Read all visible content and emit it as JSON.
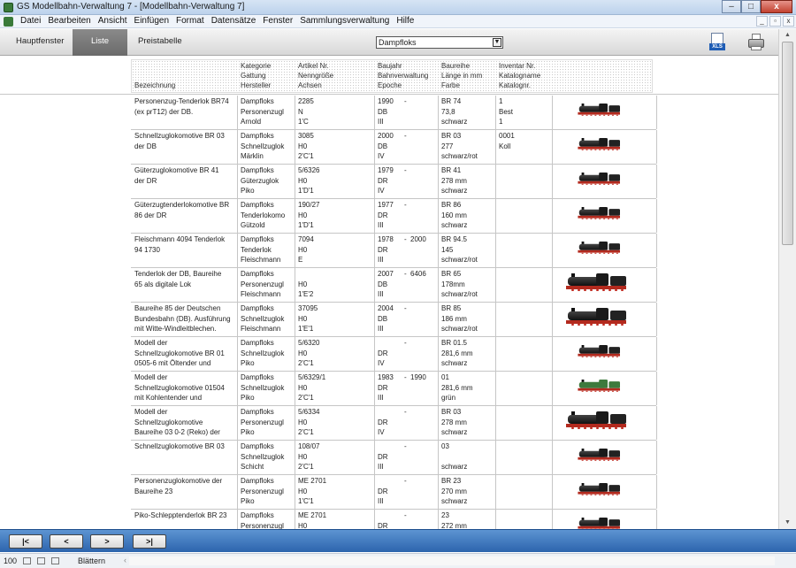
{
  "window": {
    "title": "GS Modellbahn-Verwaltung 7 - [Modellbahn-Verwaltung 7]",
    "minimize": "–",
    "maximize": "□",
    "close": "x"
  },
  "menu": [
    "Datei",
    "Bearbeiten",
    "Ansicht",
    "Einfügen",
    "Format",
    "Datensätze",
    "Fenster",
    "Sammlungsverwaltung",
    "Hilfe"
  ],
  "mdi": {
    "minimize": "_",
    "restore": "▫",
    "close": "x"
  },
  "toolbar": {
    "tabs": [
      "Hauptfenster",
      "Liste",
      "Preistabelle"
    ],
    "active_tab": "Liste",
    "category_select": "Dampfloks",
    "export_label": "XLS"
  },
  "columns": {
    "name": [
      "",
      "",
      "Bezeichnung"
    ],
    "category": [
      "Kategorie",
      "Gattung",
      "Hersteller"
    ],
    "article": [
      "Artikel Nr.",
      "Nenngröße",
      "Achsen"
    ],
    "year": [
      "Baujahr",
      "Bahnverwaltung",
      "Epoche"
    ],
    "series": [
      "Baureihe",
      "Länge in mm",
      "Farbe"
    ],
    "inventory": [
      "Inventar Nr.",
      "Katalogname",
      "Katalognr."
    ]
  },
  "rows": [
    {
      "name": [
        "Personenzug-Tenderlok BR74",
        "(ex prT12) der DB."
      ],
      "category": [
        "Dampfloks",
        "Personenzugl",
        "Arnold"
      ],
      "article": [
        "2285",
        "N",
        "1'C"
      ],
      "year": [
        "1990",
        "DB",
        "III"
      ],
      "year_dash": "-",
      "year_to": "",
      "series": [
        "BR 74",
        "73,8",
        "schwarz"
      ],
      "inventory": [
        "1",
        "Best",
        "1"
      ]
    },
    {
      "name": [
        "Schnellzuglokomotive BR 03",
        "der DB"
      ],
      "category": [
        "Dampfloks",
        "Schnellzuglok",
        "Märklin"
      ],
      "article": [
        "3085",
        "H0",
        "2'C'1"
      ],
      "year": [
        "2000",
        "DB",
        "IV"
      ],
      "year_dash": "-",
      "year_to": "",
      "series": [
        "BR 03",
        "277",
        "schwarz/rot"
      ],
      "inventory": [
        "0001",
        "Koll",
        ""
      ]
    },
    {
      "name": [
        "Güterzuglokomotive BR 41",
        "der DR"
      ],
      "category": [
        "Dampfloks",
        "Güterzuglok",
        "Piko"
      ],
      "article": [
        "5/6326",
        "H0",
        "1'D'1"
      ],
      "year": [
        "1979",
        "DR",
        "IV"
      ],
      "year_dash": "-",
      "year_to": "",
      "series": [
        "BR 41",
        "278 mm",
        "schwarz"
      ],
      "inventory": [
        "",
        "",
        ""
      ]
    },
    {
      "name": [
        "Güterzugtenderlokomotive BR",
        "86 der DR"
      ],
      "category": [
        "Dampfloks",
        "Tenderlokomo",
        "Gützold"
      ],
      "article": [
        "190/27",
        "H0",
        "1'D'1"
      ],
      "year": [
        "1977",
        "DR",
        "III"
      ],
      "year_dash": "-",
      "year_to": "",
      "series": [
        "BR 86",
        "160 mm",
        "schwarz"
      ],
      "inventory": [
        "",
        "",
        ""
      ]
    },
    {
      "name": [
        "Fleischmann 4094 Tenderlok",
        "94 1730"
      ],
      "category": [
        "Dampfloks",
        "Tenderlok",
        "Fleischmann"
      ],
      "article": [
        "7094",
        "H0",
        "E"
      ],
      "year": [
        "1978",
        "DR",
        "III"
      ],
      "year_dash": "-",
      "year_to": "2000",
      "series": [
        "BR 94.5",
        "145",
        "schwarz/rot"
      ],
      "inventory": [
        "",
        "",
        ""
      ]
    },
    {
      "name": [
        "Tenderlok der DB, Baureihe",
        "65 als digitale Lok"
      ],
      "category": [
        "Dampfloks",
        "Personenzugl",
        "Fleischmann"
      ],
      "article": [
        "",
        "H0",
        "1'E'2"
      ],
      "year": [
        "2007",
        "DB",
        "III"
      ],
      "year_dash": "-",
      "year_to": "6406",
      "series": [
        "BR 65",
        "178mm",
        "schwarz/rot"
      ],
      "inventory": [
        "",
        "",
        ""
      ]
    },
    {
      "name": [
        "Baureihe 85 der Deutschen",
        "Bundesbahn (DB). Ausführung",
        "mit Witte-Windleitblechen."
      ],
      "category": [
        "Dampfloks",
        "Schnellzuglok",
        "Fleischmann"
      ],
      "article": [
        "37095",
        "H0",
        "1'E'1"
      ],
      "year": [
        "2004",
        "DB",
        "III"
      ],
      "year_dash": "-",
      "year_to": "",
      "series": [
        "BR 85",
        "186 mm",
        "schwarz/rot"
      ],
      "inventory": [
        "",
        "",
        ""
      ]
    },
    {
      "name": [
        "Modell der",
        "Schnellzuglokomotive BR 01",
        "0505-6 mit Öltender und"
      ],
      "category": [
        "Dampfloks",
        "Schnellzuglok",
        "Piko"
      ],
      "article": [
        "5/6320",
        "H0",
        "2'C'1"
      ],
      "year": [
        "",
        "DR",
        "IV"
      ],
      "year_dash": "-",
      "year_to": "",
      "series": [
        "BR 01.5",
        "281,6 mm",
        "schwarz"
      ],
      "inventory": [
        "",
        "",
        ""
      ]
    },
    {
      "name": [
        "Modell der",
        "Schnellzuglokomotive 01504",
        "mit Kohlentender und"
      ],
      "category": [
        "Dampfloks",
        "Schnellzuglok",
        "Piko"
      ],
      "article": [
        "5/6329/1",
        "H0",
        "2'C'1"
      ],
      "year": [
        "1983",
        "DR",
        "III"
      ],
      "year_dash": "-",
      "year_to": "1990",
      "series": [
        "01",
        "281,6 mm",
        "grün"
      ],
      "inventory": [
        "",
        "",
        ""
      ]
    },
    {
      "name": [
        "Modell der",
        "Schnellzuglokomotive",
        "Baureihe 03 0-2 (Reko) der"
      ],
      "category": [
        "Dampfloks",
        "Personenzugl",
        "Piko"
      ],
      "article": [
        "5/6334",
        "H0",
        "2'C'1"
      ],
      "year": [
        "",
        "DR",
        "IV"
      ],
      "year_dash": "-",
      "year_to": "",
      "series": [
        "BR 03",
        "278 mm",
        "schwarz"
      ],
      "inventory": [
        "",
        "",
        ""
      ]
    },
    {
      "name": [
        "Schnellzuglokomotive BR 03",
        "",
        ""
      ],
      "category": [
        "Dampfloks",
        "Schnellzuglok",
        "Schicht"
      ],
      "article": [
        "108/07",
        "H0",
        "2'C'1"
      ],
      "year": [
        "",
        "DR",
        "III"
      ],
      "year_dash": "-",
      "year_to": "",
      "series": [
        "03",
        "",
        "schwarz"
      ],
      "inventory": [
        "",
        "",
        ""
      ]
    },
    {
      "name": [
        "Personenzuglokomotive der",
        "Baureihe 23"
      ],
      "category": [
        "Dampfloks",
        "Personenzugl",
        "Piko"
      ],
      "article": [
        "ME 2701",
        "H0",
        "1'C'1"
      ],
      "year": [
        "",
        "DR",
        "III"
      ],
      "year_dash": "-",
      "year_to": "",
      "series": [
        "BR 23",
        "270 mm",
        "schwarz"
      ],
      "inventory": [
        "",
        "",
        ""
      ]
    },
    {
      "name": [
        "Piko-Schlepptenderlok BR 23",
        ""
      ],
      "category": [
        "Dampfloks",
        "Personenzugl",
        ""
      ],
      "article": [
        "ME 2701",
        "H0",
        ""
      ],
      "year": [
        "",
        "DR",
        ""
      ],
      "year_dash": "-",
      "year_to": "",
      "series": [
        "23",
        "272 mm",
        ""
      ],
      "inventory": [
        "",
        "",
        ""
      ]
    }
  ],
  "nav": {
    "first": "|<",
    "prev": "<",
    "next": ">",
    "last": ">|"
  },
  "status": {
    "zoom": "100",
    "mode": "Blättern"
  },
  "colors": {
    "accent": "#2c64ad",
    "locomotive_frame": "#b32a1e"
  }
}
